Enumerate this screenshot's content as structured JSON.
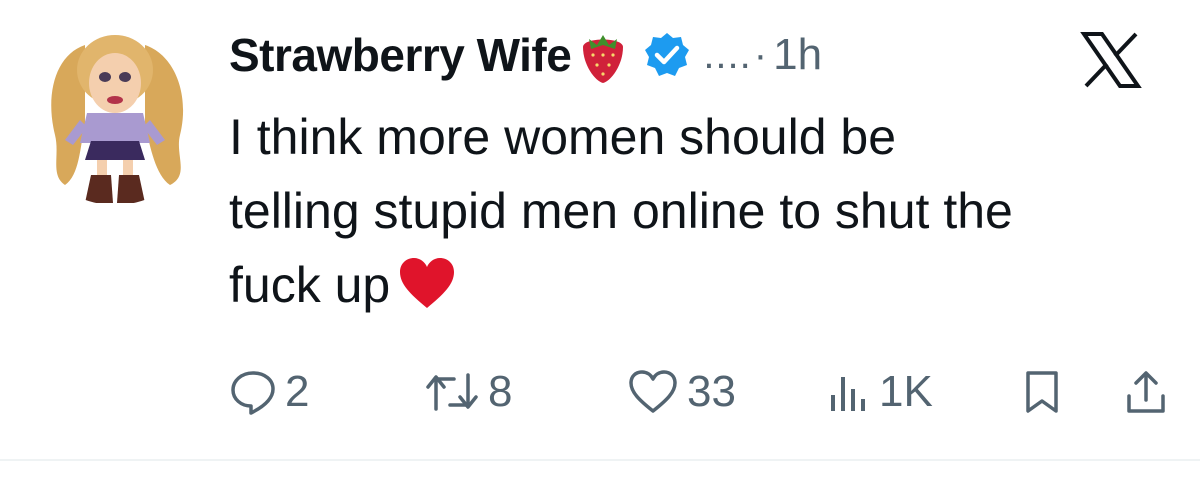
{
  "tweet": {
    "author_name": "Strawberry Wife",
    "more_indicator": "....",
    "separator": "·",
    "timestamp": "1h",
    "text_lines": [
      "I think more women should be",
      "telling stupid men online to shut the",
      "fuck up"
    ]
  },
  "actions": {
    "replies": "2",
    "reposts": "8",
    "likes": "33",
    "views": "1K"
  },
  "icons": {
    "header": [
      "strawberry-emoji-icon",
      "verified-badge-icon",
      "x-logo-icon"
    ],
    "body": [
      "red-heart-emoji-icon"
    ],
    "actions": [
      "reply-icon",
      "repost-icon",
      "like-icon",
      "views-icon",
      "bookmark-icon",
      "share-icon"
    ]
  },
  "colors": {
    "text": "#0f1419",
    "secondary": "#536471",
    "verified": "#1d9bf0",
    "heart_emoji": "#e0142b",
    "strawberry": "#d0213a"
  }
}
